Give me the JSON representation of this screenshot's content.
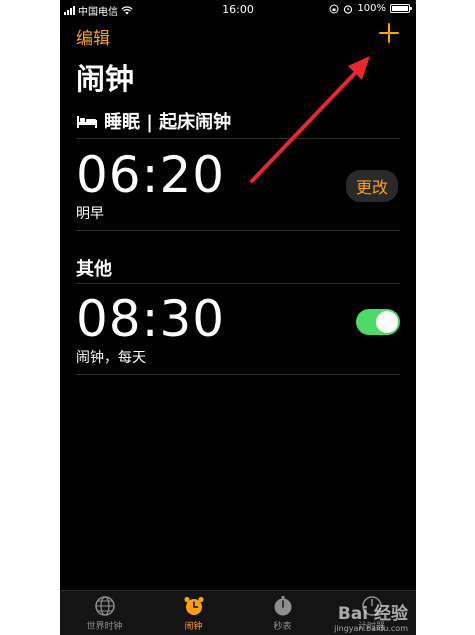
{
  "status_bar": {
    "carrier": "中国电信",
    "time": "16:00",
    "battery": "100%"
  },
  "nav": {
    "edit_label": "编辑",
    "add_icon": "plus-icon"
  },
  "page_title": "闹钟",
  "sleep_section": {
    "icon": "bed-icon",
    "title": "睡眠 | 起床闹钟",
    "alarm": {
      "time": "06:20",
      "label": "明早",
      "change_label": "更改"
    }
  },
  "other_section": {
    "title": "其他",
    "alarms": [
      {
        "time": "08:30",
        "label": "闹钟，每天",
        "enabled": true
      }
    ]
  },
  "tab_bar": {
    "tabs": [
      {
        "label": "世界时钟",
        "icon": "globe-icon",
        "active": false
      },
      {
        "label": "闹钟",
        "icon": "alarm-clock-icon",
        "active": true
      },
      {
        "label": "秒表",
        "icon": "stopwatch-icon",
        "active": false
      },
      {
        "label": "计时器",
        "icon": "timer-icon",
        "active": false
      }
    ]
  },
  "watermark": {
    "logo": "Bai 经验",
    "url": "jingyan.baidu.com"
  },
  "colors": {
    "accent": "#ff9f0a",
    "toggle_on": "#4cd964",
    "annotation_arrow": "#e8262b",
    "background": "#000000"
  }
}
